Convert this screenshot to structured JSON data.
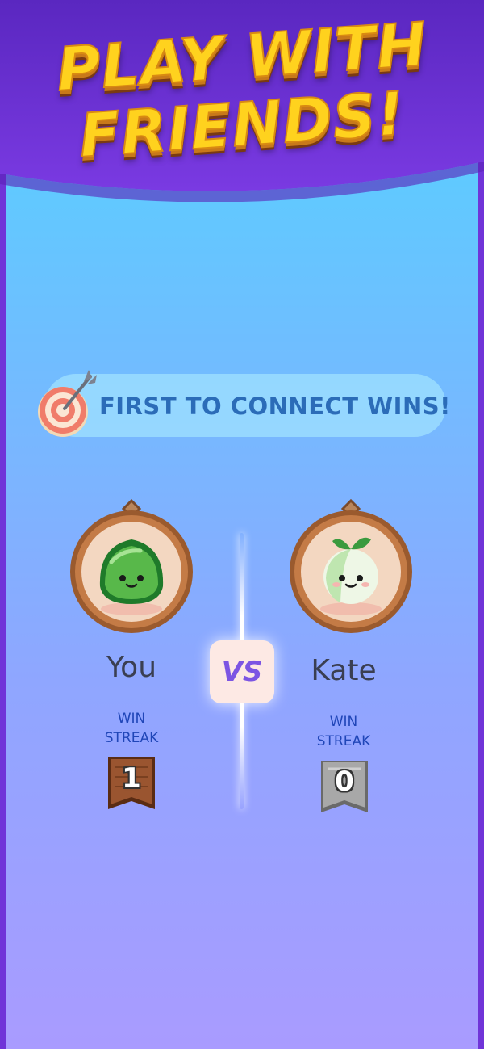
{
  "header": {
    "line1": "PLAY WITH",
    "line2": "FRIENDS!"
  },
  "goal": {
    "text": "FIRST TO CONNECT WINS!",
    "icon": "target-icon"
  },
  "versus_label": "VS",
  "players": [
    {
      "name": "You",
      "streak_label_1": "WIN",
      "streak_label_2": "STREAK",
      "streak": "1",
      "badge_color": "#8a4a25",
      "avatar": "green-blob-avatar"
    },
    {
      "name": "Kate",
      "streak_label_1": "WIN",
      "streak_label_2": "STREAK",
      "streak": "0",
      "badge_color": "#9a9a9a",
      "avatar": "onion-sprout-avatar"
    }
  ],
  "colors": {
    "banner": "#6a2ed0",
    "headline": "#ffd21e",
    "accent": "#7c55e3"
  }
}
